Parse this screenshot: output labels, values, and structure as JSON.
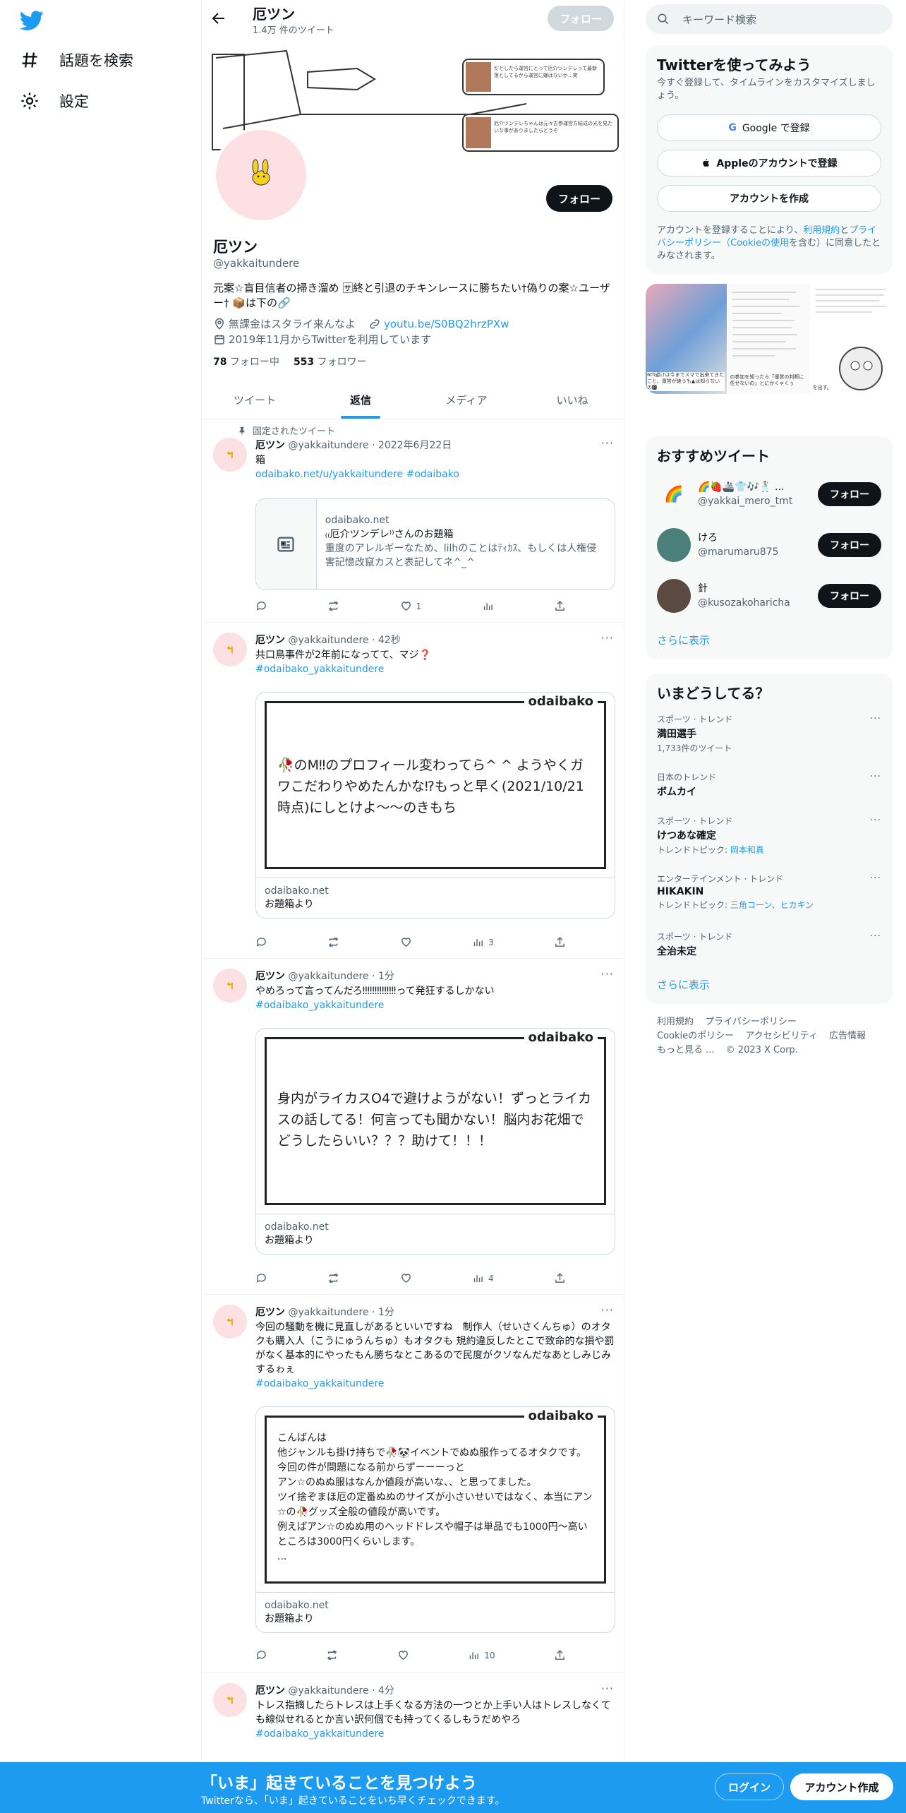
{
  "nav": {
    "explore_label": "話題を検索",
    "settings_label": "設定"
  },
  "header": {
    "name": "厄ツン",
    "tweet_count": "1.4万 件のツイート",
    "follow_label": "フォロー"
  },
  "profile": {
    "name": "厄ツン",
    "handle": "@yakkaitundere",
    "follow_label": "フォロー",
    "bio": "元案☆盲目信者の掃き溜め 🈂終と引退のチキンレースに勝ちたい†偽りの案☆ユーザー† 📦は下の🔗",
    "location": "無課金はスタライ来んなよ",
    "url": "youtu.be/S0BQ2hrzPXw",
    "joined": "2019年11月からTwitterを利用しています",
    "following_count": "78",
    "following_label": "フォロー中",
    "followers_count": "553",
    "followers_label": "フォロワー",
    "banner_notes": [
      "だとしたら運営にとって厄介ツンデレって最新落としてるから運営に嫌はないか…笑",
      "厄介ツンデレちゃんは元々古参運営方結成の光を見たいな事がありましたらどうぞ"
    ]
  },
  "tabs": [
    "ツイート",
    "返信",
    "メディア",
    "いいね"
  ],
  "tweets": [
    {
      "pinned_label": "固定されたツイート",
      "name": "厄ツン",
      "handle": "@yakkaitundere",
      "time": "2022年6月22日",
      "text": "箱",
      "link": "odaibako.net/u/yakkaitundere #odaibako",
      "card_domain": "odaibako.net",
      "card_title": "₍₍厄介ツンデレ⁾⁾さんのお題箱",
      "card_desc": "重度のアレルギーなため、lilhのことはﾃｨｶｽ、もしくは人権侵害記憶改竄カスと表記してネ^_^",
      "likes": "1",
      "views": ""
    },
    {
      "name": "厄ツン",
      "handle": "@yakkaitundere",
      "time": "42秒",
      "text": "共口鳥事件が2年前になってて、マジ❓",
      "tag": "#odaibako_yakkaitundere",
      "brand": "odaibako",
      "message": "🥀のM‼のプロフィール変わってら^ ^ ようやくガワこだわりやめたんかな⁉もっと早く(2021/10/21時点)にしとけよ〜〜のきもち",
      "card_domain": "odaibako.net",
      "card_title": "お題箱より",
      "views": "3"
    },
    {
      "name": "厄ツン",
      "handle": "@yakkaitundere",
      "time": "1分",
      "text": "やめろって言ってんだろ‼‼‼‼‼‼‼って発狂するしかない",
      "tag": "#odaibako_yakkaitundere",
      "brand": "odaibako",
      "message": "身内がライカスO4で避けようがない！ずっとライカスの話してる！何言っても聞かない！脳内お花畑でどうしたらいい？？？助けて！！！",
      "card_domain": "odaibako.net",
      "card_title": "お題箱より",
      "views": "4"
    },
    {
      "name": "厄ツン",
      "handle": "@yakkaitundere",
      "time": "1分",
      "text": "今回の騒動を機に見直しがあるといいですね　制作人（せいさくんちゅ）のオタクも購入人（こうにゅうんちゅ）もオタクも 規約違反したとこで致命的な損や罰がなく基本的にやったもん勝ちなとこあるので民度がクソなんだなあとしみじみするゎぇ",
      "tag": "#odaibako_yakkaitundere",
      "brand": "odaibako",
      "message": "こんばんは\n他ジャンルも掛け持ちで🥀🐼イベントでぬぬ服作ってるオタクです。\n今回の件が問題になる前からずーーーっと\nアン☆のぬぬ服はなんか値段が高いな、、と思ってました。\nツイ捨ぞまほ厄の定番ぬぬのサイズが小さいせいではなく、本当にアン☆の🥀グッズ全般の値段が高いです。\n例えばアン☆のぬぬ用のヘッドドレスや帽子は単品でも1000円〜高いところは3000円くらいします。\n...",
      "card_domain": "odaibako.net",
      "card_title": "お題箱より",
      "views": "10"
    },
    {
      "name": "厄ツン",
      "handle": "@yakkaitundere",
      "time": "4分",
      "text": "トレス指摘したらトレスは上手くなる方法の一つとか上手い人はトレスしなくても線似せれるとか言い訳何個でも持ってくるしもうだめやろ",
      "tag": "#odaibako_yakkaitundere"
    }
  ],
  "right": {
    "search_placeholder": "キーワード検索",
    "signup": {
      "title": "Twitterを使ってみよう",
      "sub": "今すぐ登録して、タイムラインをカスタマイズしましょう。",
      "google": "Google で登録",
      "apple": "Appleのアカウントで登録",
      "create": "アカウントを作成",
      "legal_pre": "アカウントを登録することにより、",
      "legal_terms": "利用規約",
      "legal_and": "と",
      "legal_privacy": "プライバシーポリシー",
      "legal_cookie": "（Cookieの使用",
      "legal_post": "を含む）に同意したとみなされます。"
    },
    "photo_text": [
      "6th避けは今までスマで出来てきたこと、運営が絶うも▲は知らないの🅿",
      "の参加を知ったら「運営の判断に任せないの」とにかくゃくぅ",
      "を出す。"
    ],
    "recommend": {
      "title": "おすすめツイート",
      "users": [
        {
          "name": "🌈🍓🚢👕🎶🕺 ...",
          "handle": "@yakkai_mero_tmt"
        },
        {
          "name": "けろ",
          "handle": "@marumaru875"
        },
        {
          "name": "針",
          "handle": "@kusozakoharicha"
        }
      ],
      "follow_label": "フォロー",
      "more": "さらに表示"
    },
    "trends": {
      "title": "いまどうしてる？",
      "items": [
        {
          "cat": "スポーツ · トレンド",
          "name": "満田選手",
          "sub": "1,733件のツイート",
          "topic": ""
        },
        {
          "cat": "日本のトレンド",
          "name": "ボムカイ",
          "sub": "",
          "topic": ""
        },
        {
          "cat": "スポーツ · トレンド",
          "name": "けつあな確定",
          "sub": "トレンドトピック: ",
          "topic": "岡本和真"
        },
        {
          "cat": "エンターテインメント · トレンド",
          "name": "HIKAKIN",
          "sub": "トレンドトピック: ",
          "topic": "三角コーン、ヒカキン"
        },
        {
          "cat": "スポーツ · トレンド",
          "name": "全治未定",
          "sub": "",
          "topic": ""
        }
      ],
      "more": "さらに表示"
    },
    "footer": [
      "利用規約",
      "プライバシーポリシー",
      "Cookieのポリシー",
      "アクセシビリティ",
      "広告情報",
      "もっと見る ...",
      "© 2023 X Corp."
    ]
  },
  "bottombar": {
    "title": "「いま」起きていることを見つけよう",
    "sub": "Twitterなら、「いま」起きていることをいち早くチェックできます。",
    "login": "ログイン",
    "signup": "アカウント作成"
  },
  "colors": {
    "accent": "#1d9bf0",
    "text": "#0f1419",
    "muted": "#536471"
  }
}
